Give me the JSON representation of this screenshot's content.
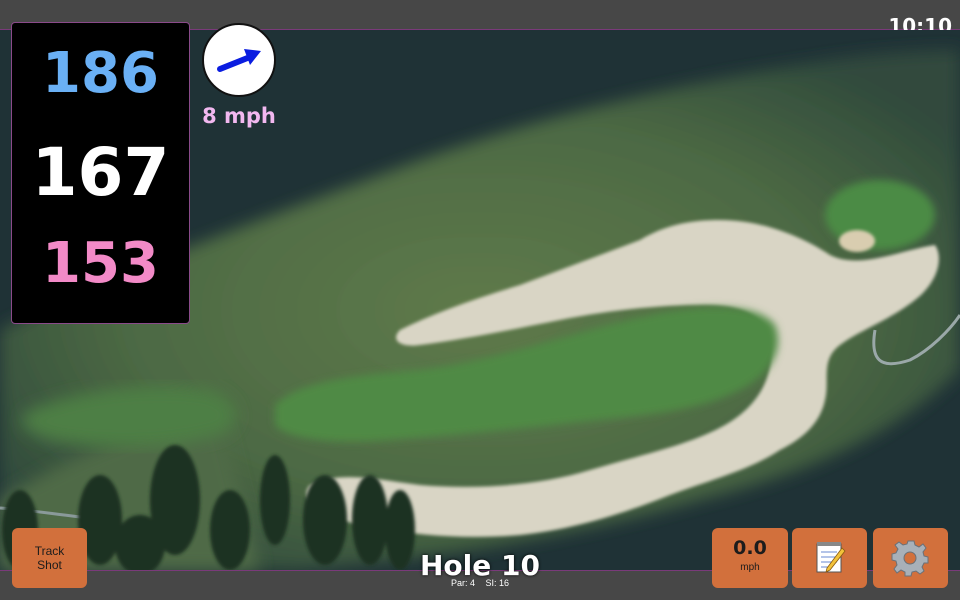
{
  "status_bar": {
    "time": "10:10"
  },
  "distances": {
    "back": "186",
    "middle": "167",
    "front": "153"
  },
  "wind": {
    "speed": "8 mph",
    "direction_icon": "wind-arrow-icon"
  },
  "hole": {
    "title": "Hole 10",
    "par": "Par: 4",
    "stroke_index": "SI: 16"
  },
  "buttons": {
    "track_shot_line1": "Track",
    "track_shot_line2": "Shot",
    "speed_value": "0.0",
    "speed_unit": "mph",
    "notes_icon": "notepad-icon",
    "settings_icon": "gear-icon"
  },
  "colors": {
    "back_distance": "#6ab0f5",
    "middle_distance": "#ffffff",
    "front_distance": "#f28ac7",
    "wind_text": "#f2b8f0",
    "button_bg": "#d2703c"
  }
}
